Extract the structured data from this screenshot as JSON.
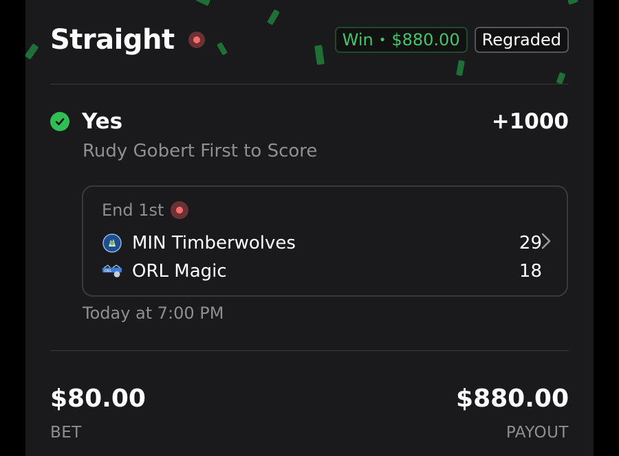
{
  "header": {
    "title": "Straight",
    "win_label": "Win",
    "win_separator": "•",
    "win_amount": "$880.00",
    "status_badge": "Regraded"
  },
  "pick": {
    "selection": "Yes",
    "odds": "+1000",
    "market": "Rudy Gobert First to Score"
  },
  "game": {
    "period": "End 1st",
    "teams": [
      {
        "name": "MIN Timberwolves",
        "score": "29",
        "logo_icon": "timberwolves-logo-icon"
      },
      {
        "name": "ORL Magic",
        "score": "18",
        "logo_icon": "magic-logo-icon"
      }
    ],
    "start_time": "Today at 7:00 PM"
  },
  "summary": {
    "bet_amount": "$80.00",
    "bet_label": "BET",
    "payout_amount": "$880.00",
    "payout_label": "PAYOUT"
  },
  "colors": {
    "win_green": "#45c468",
    "live_red": "#ff6b6b",
    "card_bg": "#1a1a1c",
    "muted_text": "#8e8e93"
  }
}
